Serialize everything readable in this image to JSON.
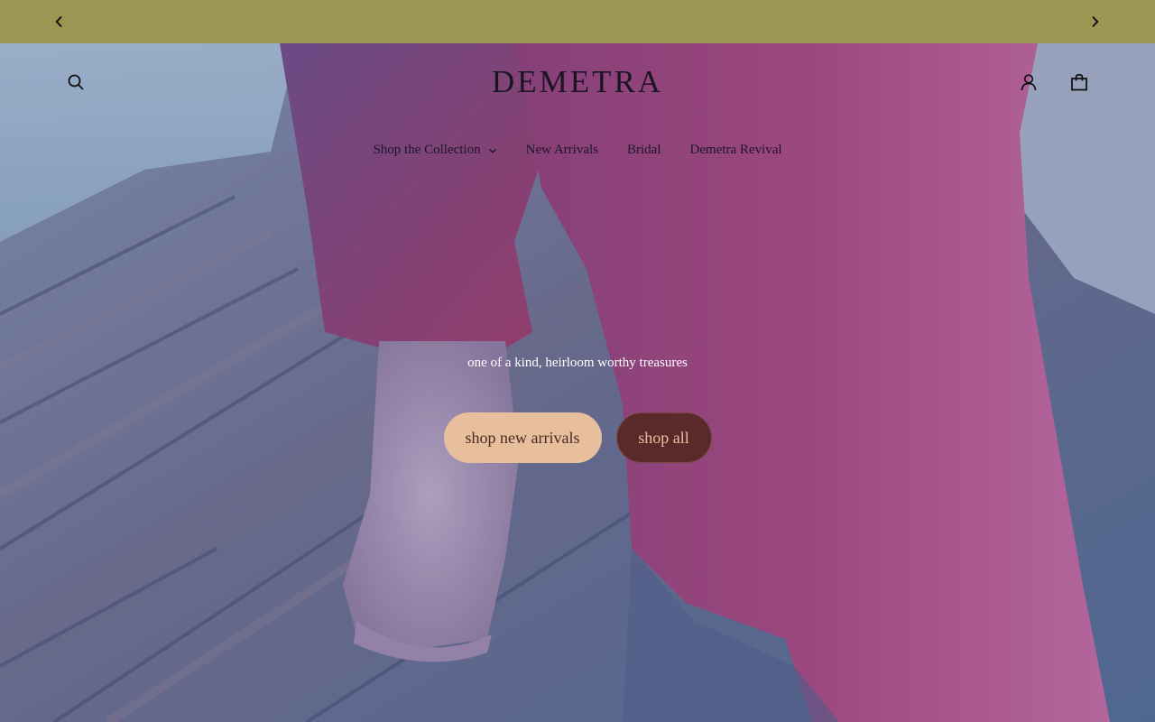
{
  "announcement": {
    "prev_icon": "chevron-left-icon",
    "next_icon": "chevron-right-icon",
    "background": "#9d9652"
  },
  "header": {
    "logo": "DEMETRA",
    "search_icon": "search-icon",
    "account_icon": "user-icon",
    "cart_icon": "shopping-bag-icon"
  },
  "nav": {
    "items": [
      {
        "label": "Shop the Collection",
        "has_dropdown": true
      },
      {
        "label": "New Arrivals"
      },
      {
        "label": "Bridal"
      },
      {
        "label": "Demetra Revival"
      }
    ]
  },
  "hero": {
    "tagline": "one of a kind, heirloom worthy treasures",
    "primary_cta": "shop new arrivals",
    "secondary_cta": "shop all",
    "primary_color": "#e8bf9c",
    "secondary_color": "#5a2a2b"
  }
}
